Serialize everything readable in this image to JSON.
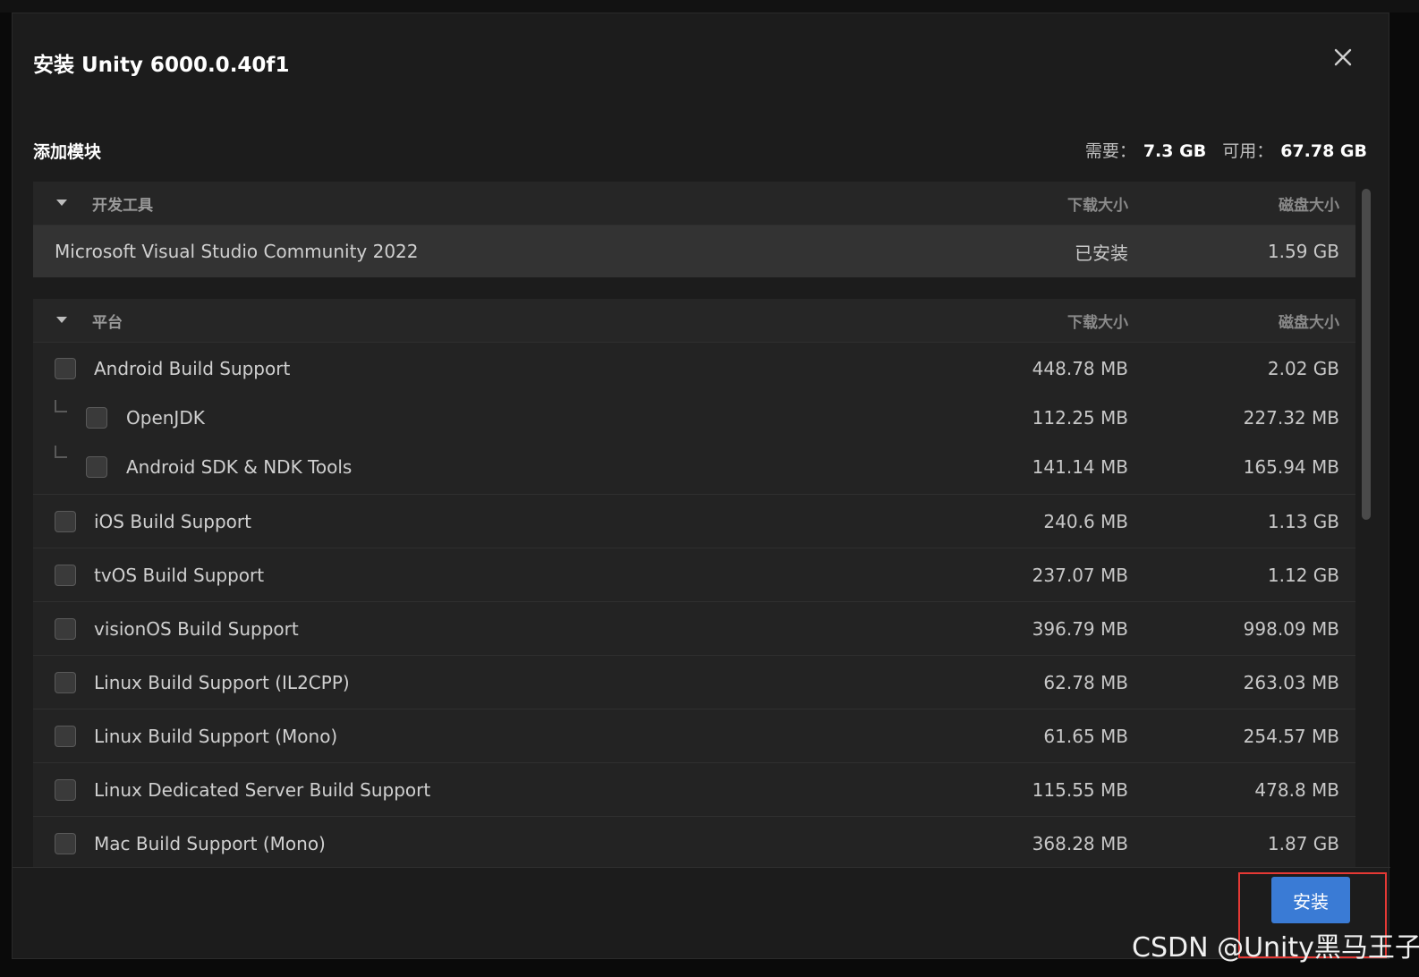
{
  "dialog": {
    "title": "安装 Unity 6000.0.40f1",
    "section_label": "添加模块",
    "space": {
      "required_label": "需要：",
      "required_value": "7.3 GB",
      "available_label": "可用：",
      "available_value": "67.78 GB"
    },
    "install_label": "安装"
  },
  "groups": {
    "dev_tools": {
      "title": "开发工具",
      "col_download": "下载大小",
      "col_disk": "磁盘大小",
      "items": [
        {
          "name": "Microsoft Visual Studio Community 2022",
          "download": "已安装",
          "disk": "1.59 GB"
        }
      ]
    },
    "platforms": {
      "title": "平台",
      "col_download": "下载大小",
      "col_disk": "磁盘大小",
      "items": [
        {
          "name": "Android Build Support",
          "download": "448.78 MB",
          "disk": "2.02 GB"
        },
        {
          "name": "OpenJDK",
          "download": "112.25 MB",
          "disk": "227.32 MB"
        },
        {
          "name": "Android SDK & NDK Tools",
          "download": "141.14 MB",
          "disk": "165.94 MB"
        },
        {
          "name": "iOS Build Support",
          "download": "240.6 MB",
          "disk": "1.13 GB"
        },
        {
          "name": "tvOS Build Support",
          "download": "237.07 MB",
          "disk": "1.12 GB"
        },
        {
          "name": "visionOS Build Support",
          "download": "396.79 MB",
          "disk": "998.09 MB"
        },
        {
          "name": "Linux Build Support (IL2CPP)",
          "download": "62.78 MB",
          "disk": "263.03 MB"
        },
        {
          "name": "Linux Build Support (Mono)",
          "download": "61.65 MB",
          "disk": "254.57 MB"
        },
        {
          "name": "Linux Dedicated Server Build Support",
          "download": "115.55 MB",
          "disk": "478.8 MB"
        },
        {
          "name": "Mac Build Support (Mono)",
          "download": "368.28 MB",
          "disk": "1.87 GB"
        }
      ]
    }
  },
  "watermark": "CSDN @Unity黑马王子",
  "colors": {
    "accent": "#3a7bd5",
    "highlight": "#e53935",
    "background": "#1c1c1c"
  },
  "icons": {
    "close": "close-icon",
    "collapse": "caret-down-icon"
  }
}
